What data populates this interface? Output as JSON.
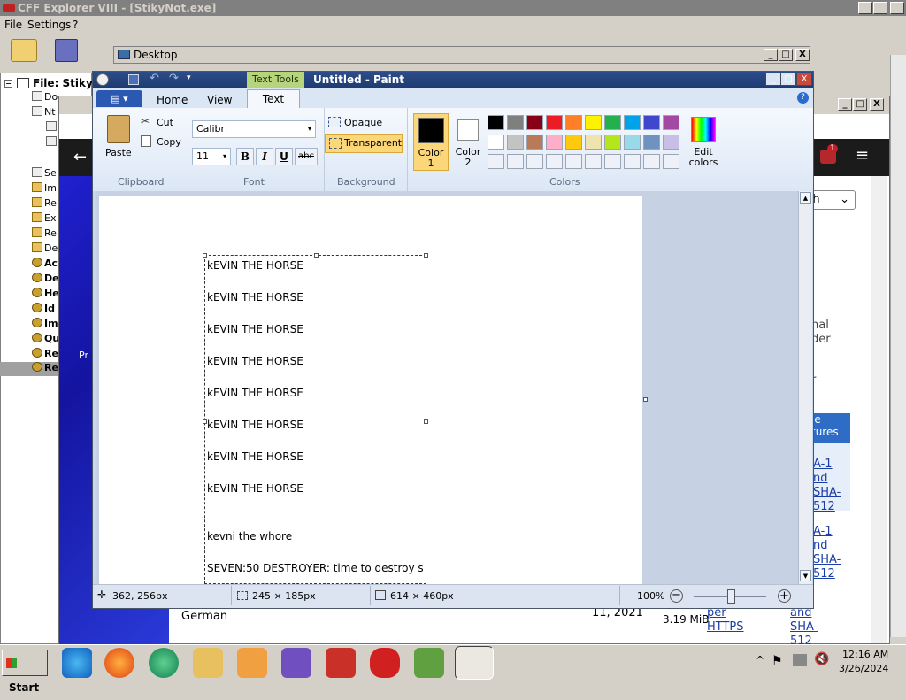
{
  "cff": {
    "title": "CFF Explorer VIII - [StikyNot.exe]",
    "menu": [
      "File",
      "Settings",
      "?"
    ],
    "tree_root": "File: StikyN",
    "tree_items": [
      "Do",
      "Nt",
      "",
      "",
      "Se",
      "Im",
      "Re",
      "Ex",
      "Re",
      "De",
      "Ac",
      "De",
      "He",
      "Id",
      "Im",
      "Qu",
      "Re",
      "Re"
    ],
    "min": "_",
    "max": "□",
    "close": "X"
  },
  "desktop": {
    "title": "Desktop"
  },
  "browser": {
    "lang_select": "ish",
    "badge": "1",
    "col_text": [
      "nal",
      "der",
      "r"
    ],
    "col_header": "le\ntures",
    "sha_links": [
      "A-1 nd SHA-512",
      "A-1 nd SHA-512",
      "A-1 and SHA-512"
    ],
    "bottom": {
      "lang": "German",
      "date": "11, 2021",
      "size": "3.19 MiB",
      "proto": "per HTTPS"
    },
    "left_labels": [
      "Pr"
    ]
  },
  "paint": {
    "title": "Untitled - Paint",
    "text_tools": "Text Tools",
    "tabs": [
      "Home",
      "View",
      "Text"
    ],
    "clipboard": {
      "paste": "Paste",
      "cut": "Cut",
      "copy": "Copy",
      "label": "Clipboard"
    },
    "font": {
      "family": "Calibri",
      "size": "11",
      "bold": "B",
      "italic": "I",
      "underline": "U",
      "strike": "abc",
      "label": "Font"
    },
    "background": {
      "opaque": "Opaque",
      "transparent": "Transparent",
      "label": "Background"
    },
    "colors": {
      "color1": "Color\n1",
      "color2": "Color\n2",
      "edit": "Edit\ncolors",
      "label": "Colors",
      "row1": [
        "#000000",
        "#7f7f7f",
        "#880015",
        "#ed1c24",
        "#ff7f27",
        "#fff200",
        "#22b14c",
        "#00a2e8",
        "#3f48cc",
        "#a349a4"
      ],
      "row2": [
        "#ffffff",
        "#c3c3c3",
        "#b97a57",
        "#ffaec9",
        "#ffc90e",
        "#efe4b0",
        "#b5e61d",
        "#99d9ea",
        "#7092be",
        "#c8bfe7"
      ]
    },
    "canvas_lines": [
      "kEVIN THE HORSE",
      "kEVIN THE HORSE",
      "kEVIN THE HORSE",
      "kEVIN THE HORSE",
      "kEVIN THE HORSE",
      "kEVIN THE HORSE",
      "kEVIN THE HORSE",
      "kEVIN THE HORSE",
      "",
      "kevni the whore",
      "SEVEN:50 DESTROYER: time to destroy s"
    ],
    "status": {
      "cursor": "362, 256px",
      "selection": "245 × 185px",
      "size": "614 × 460px",
      "zoom": "100%"
    }
  },
  "taskbar": {
    "start": "Start",
    "time": "12:16 AM",
    "date": "3/26/2024"
  }
}
